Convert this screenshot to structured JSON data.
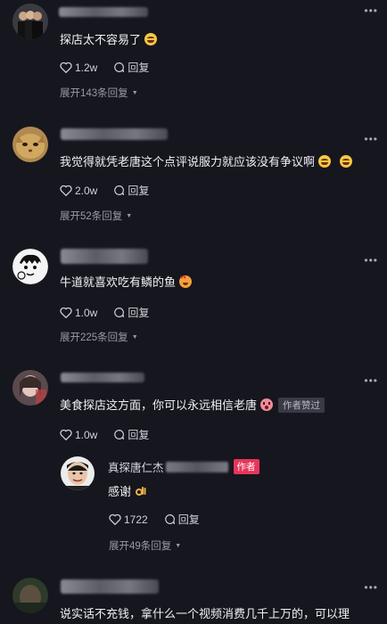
{
  "comments": [
    {
      "text": "探店太不容易了",
      "likes": "1.2w",
      "reply_label": "回复",
      "expand": "展开143条回复"
    },
    {
      "text": "我觉得就凭老唐这个点评说服力就应该没有争议啊",
      "likes": "2.0w",
      "reply_label": "回复",
      "expand": "展开52条回复"
    },
    {
      "text": "牛道就喜欢吃有鳞的鱼",
      "likes": "1.0w",
      "reply_label": "回复",
      "expand": "展开225条回复"
    },
    {
      "text": "美食探店这方面，你可以永远相信老唐",
      "badge": "作者赞过",
      "likes": "1.0w",
      "reply_label": "回复",
      "reply": {
        "name": "真探唐仁杰",
        "tag": "作者",
        "text": "感谢",
        "likes": "1722",
        "reply_label": "回复",
        "expand": "展开49条回复"
      }
    },
    {
      "text": "说实话不充钱，拿什么一个视频消费几千上万的，可以理"
    }
  ],
  "more_glyph": "•••",
  "icons": {
    "like": "heart-outline-icon",
    "reply": "reply-bubble-icon",
    "more": "more-dots-icon"
  },
  "colors": {
    "background": "#16161f",
    "text": "#f0f0f4",
    "muted": "#9a9aa6",
    "author_tag": "#e8355a"
  }
}
